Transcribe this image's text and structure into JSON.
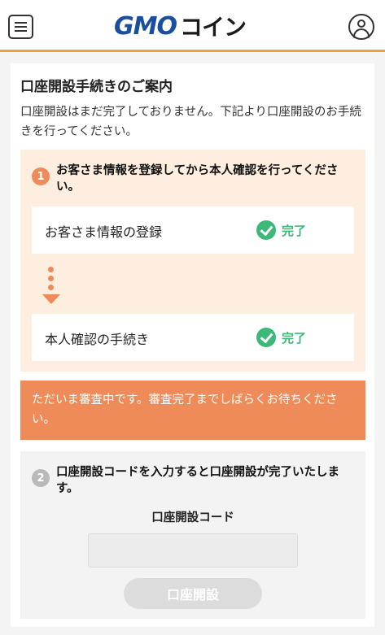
{
  "header": {
    "logo_gmo": "GMO",
    "logo_coin": "コイン"
  },
  "page": {
    "title": "口座開設手続きのご案内",
    "description": "口座開設はまだ完了しておりません。下記より口座開設のお手続きを行ってください。"
  },
  "step1": {
    "number": "1",
    "heading": "お客さま情報を登録してから本人確認を行ってください。",
    "rows": [
      {
        "label": "お客さま情報の登録",
        "status": "完了"
      },
      {
        "label": "本人確認の手続き",
        "status": "完了"
      }
    ]
  },
  "notice": {
    "text": "ただいま審査中です。審査完了までしばらくお待ちください。"
  },
  "step2": {
    "number": "2",
    "heading": "口座開設コードを入力すると口座開設が完了いたします。",
    "code_label": "口座開設コード",
    "code_value": "",
    "submit_label": "口座開設"
  },
  "colors": {
    "accent_orange": "#ef8a59",
    "header_border": "#f0a23c",
    "success_green": "#3cb878",
    "brand_blue": "#1a4fa0"
  }
}
